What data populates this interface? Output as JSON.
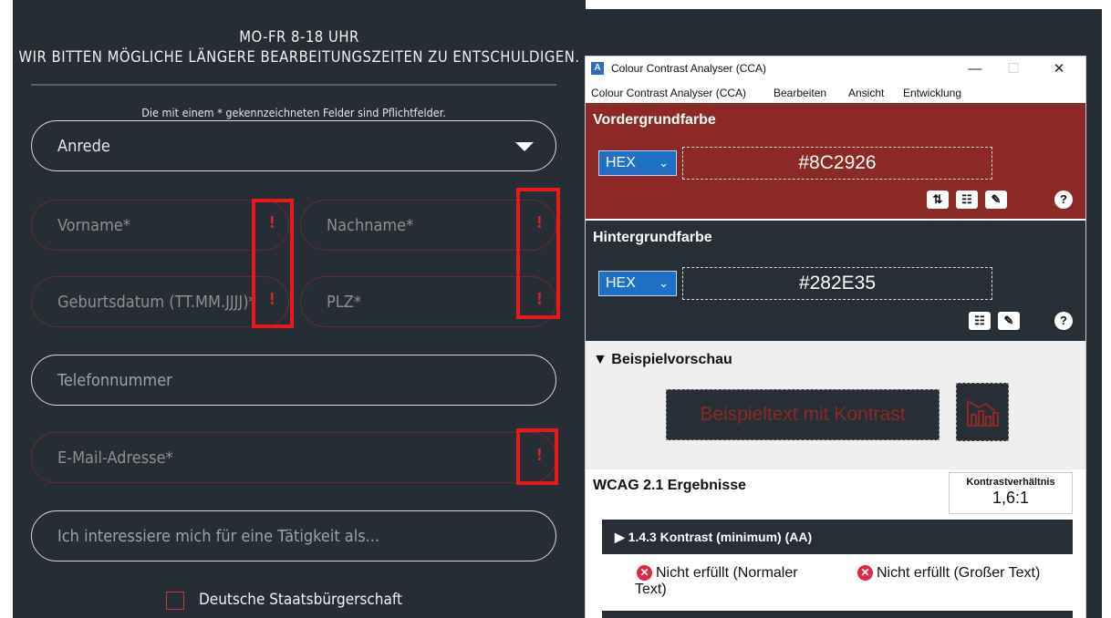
{
  "form": {
    "hours_line1": "MO-FR 8-18 UHR",
    "hours_line2": "WIR BITTEN MÖGLICHE LÄNGERE BEARBEITUNGSZEITEN ZU ENTSCHULDIGEN.",
    "mandatory_note": "Die mit einem * gekennzeichneten Felder sind Pflichtfelder.",
    "salutation": "Anrede",
    "first_name_placeholder": "Vorname*",
    "last_name_placeholder": "Nachname*",
    "birthdate_placeholder": "Geburtsdatum (TT.MM.JJJJ)*",
    "zip_placeholder": "PLZ*",
    "phone_placeholder": "Telefonnummer",
    "email_placeholder": "E-Mail-Adresse*",
    "interest_placeholder": "Ich interessiere mich für eine Tätigkeit als...",
    "error_mark": "!",
    "citizenship_label": "Deutsche Staatsbürgerschaft",
    "citizenship_checked": false
  },
  "cca": {
    "window_title": "Colour Contrast Analyser (CCA)",
    "app_icon_glyph": "A",
    "window_controls": {
      "minimize": "—",
      "maximize": "☐",
      "close": "✕"
    },
    "menu": [
      "Colour Contrast Analyser (CCA)",
      "Bearbeiten",
      "Ansicht",
      "Entwicklung"
    ],
    "foreground": {
      "title": "Vordergrundfarbe",
      "format": "HEX",
      "value": "#8C2926",
      "tools": [
        "swap-icon",
        "sliders-icon",
        "eyedropper-icon",
        "help-icon"
      ],
      "tool_glyphs": [
        "⇅",
        "☷",
        "✎",
        "?"
      ]
    },
    "background": {
      "title": "Hintergrundfarbe",
      "format": "HEX",
      "value": "#282E35",
      "tools": [
        "sliders-icon",
        "eyedropper-icon",
        "help-icon"
      ],
      "tool_glyphs": [
        "☷",
        "✎",
        "?"
      ]
    },
    "preview": {
      "title": "▼ Beispielvorschau",
      "sample_text": "Beispieltext mit Kontrast"
    },
    "results": {
      "title": "WCAG 2.1 Ergebnisse",
      "ratio_label": "Kontrastverhältnis",
      "ratio_value": "1,6:1",
      "criterion": "▶ 1.4.3 Kontrast (minimum) (AA)",
      "fail_normal_line1": "Nicht erfüllt (Normaler",
      "fail_normal_line2": "Text)",
      "fail_large": "Nicht erfüllt (Großer Text)",
      "fail_glyph": "✕"
    },
    "colors": {
      "foreground": "#8C2926",
      "background": "#282E35",
      "select_blue": "#1f6fc5",
      "fail_red": "#e0284b"
    }
  },
  "annotation_color": "#e8191c"
}
